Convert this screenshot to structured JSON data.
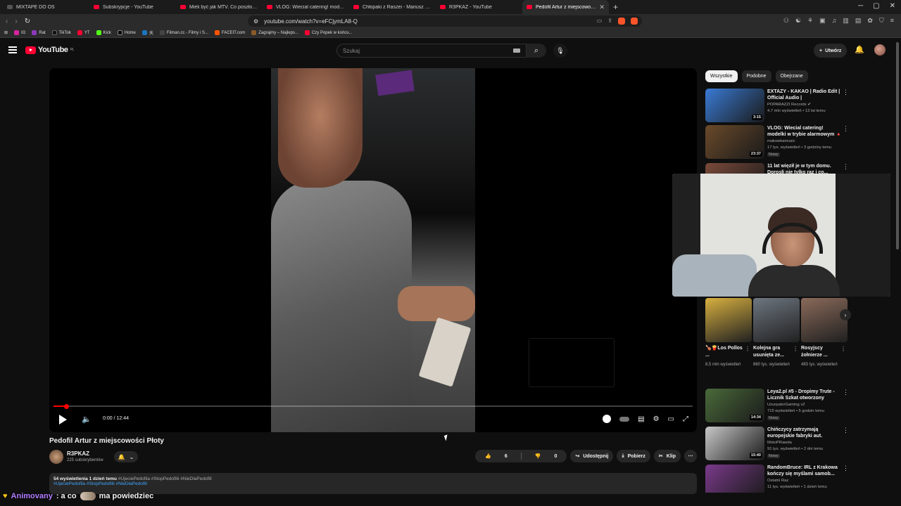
{
  "browser": {
    "tabs": [
      {
        "title": "MIXTAPE DO OS"
      },
      {
        "title": "Subskrypcje - YouTube"
      },
      {
        "title": "Mieli być jak MTV. Co poszło nie tak"
      },
      {
        "title": "VLOG: Wiecial catering! modelki w tr"
      },
      {
        "title": "Chłopaki z Raszei - Mariusz robi pop"
      },
      {
        "title": "R3PKAZ - YouTube"
      },
      {
        "title": "Pedofil Artur z miejscowości Płoty"
      }
    ],
    "url": "youtube.com/watch?v=eFCjymLA8-Q",
    "bookmarks": [
      "IG",
      "Rat",
      "TikTok",
      "YT",
      "Kick",
      "Home",
      "天",
      "Filman.cc - Filmy i S...",
      "FACEIT.com",
      "Zagrajmy – Najleps...",
      "Czy Popek w końcu..."
    ]
  },
  "youtube": {
    "logo": "YouTube",
    "region": "PL",
    "search_placeholder": "Szukaj",
    "create_label": "Utwórz"
  },
  "player": {
    "time": "0:00 / 12:44",
    "progress": 0.02
  },
  "video": {
    "title": "Pedofil Artur z miejscowości Płoty",
    "channel": "R3PKAZ",
    "subscribers": "225 subskrybentów",
    "likes": "6",
    "dislikes": "0",
    "share": "Udostępnij",
    "download": "Pobierz",
    "clip": "Klip",
    "description": {
      "stats": "54 wyświetlenia  1 dzień temu",
      "tags_inline": "#UjeciePedofila #StopPedofilii #NieDlaPedofili",
      "tags_line2": "#UjeciePedofila #StopPedofilii #NieDlaPedofili"
    }
  },
  "sidebar": {
    "chips": [
      "Wszystkie",
      "Podobne",
      "Obejrzane"
    ],
    "recs_top": [
      {
        "title": "EXTAZY - KAKAO | Radio Edit | Official Audio |",
        "channel": "POPARAZZI Records ✔",
        "meta": "4,7 mln wyświetleń • 13 lat temu",
        "duration": "3:15",
        "color": "#3a7bd5"
      },
      {
        "title": "VLOG: Wiecial catering! modelki w trybie alarmowym 🔺",
        "channel": "makowkamusic",
        "meta": "17 tys. wyświetleń • 3 godziny temu",
        "duration": "23:37",
        "badge": "Nowy",
        "color": "#6a4a2a"
      },
      {
        "title": "11 lat więził je w tym domu. Dorosłi nie tylko raz i co...",
        "channel": "",
        "meta": "",
        "duration": "",
        "color": "#7a4a3a"
      }
    ],
    "shorts": [
      {
        "title": "🍗🍟Los Pollos ...",
        "views": "8,5 mln wyświetleń",
        "color": "#d8b040"
      },
      {
        "title": "Kolejna gra usunięta ze...",
        "views": "860 tys. wyświetleń",
        "color": "#6e7680"
      },
      {
        "title": "Rosyjscy żołnierze ...",
        "views": "483 tys. wyświetleń",
        "color": "#8a6a5a"
      }
    ],
    "recs_bottom": [
      {
        "title": "Leya2.pl #5 - Dropimy Trute - Licznik Szkat otworzony",
        "channel": "UzurpatorGaming v2",
        "meta": "715 wyświetleń • 5 godzin temu",
        "duration": "14:34",
        "badge": "Nowy",
        "color": "#4a6a3a"
      },
      {
        "title": "Chińczycy zatrzymają europejskie fabryki aut. Wraca...",
        "channel": "MotoPRawda",
        "meta": "91 tys. wyświetleń • 2 dni temu",
        "duration": "15:40",
        "badge": "Nowy",
        "color": "#c8c8c8"
      },
      {
        "title": "RandomBruce: IRL z Krakowa kończy się myślami samob...",
        "channel": "Ostatni Raz",
        "meta": "11 tys. wyświetleń • 1 dzień temu",
        "duration": "",
        "color": "#7a3a8a"
      }
    ]
  },
  "overlay": {
    "chat_user": "Animovany",
    "chat_text_1": ": a co",
    "chat_text_2": "ma powiedziec"
  }
}
